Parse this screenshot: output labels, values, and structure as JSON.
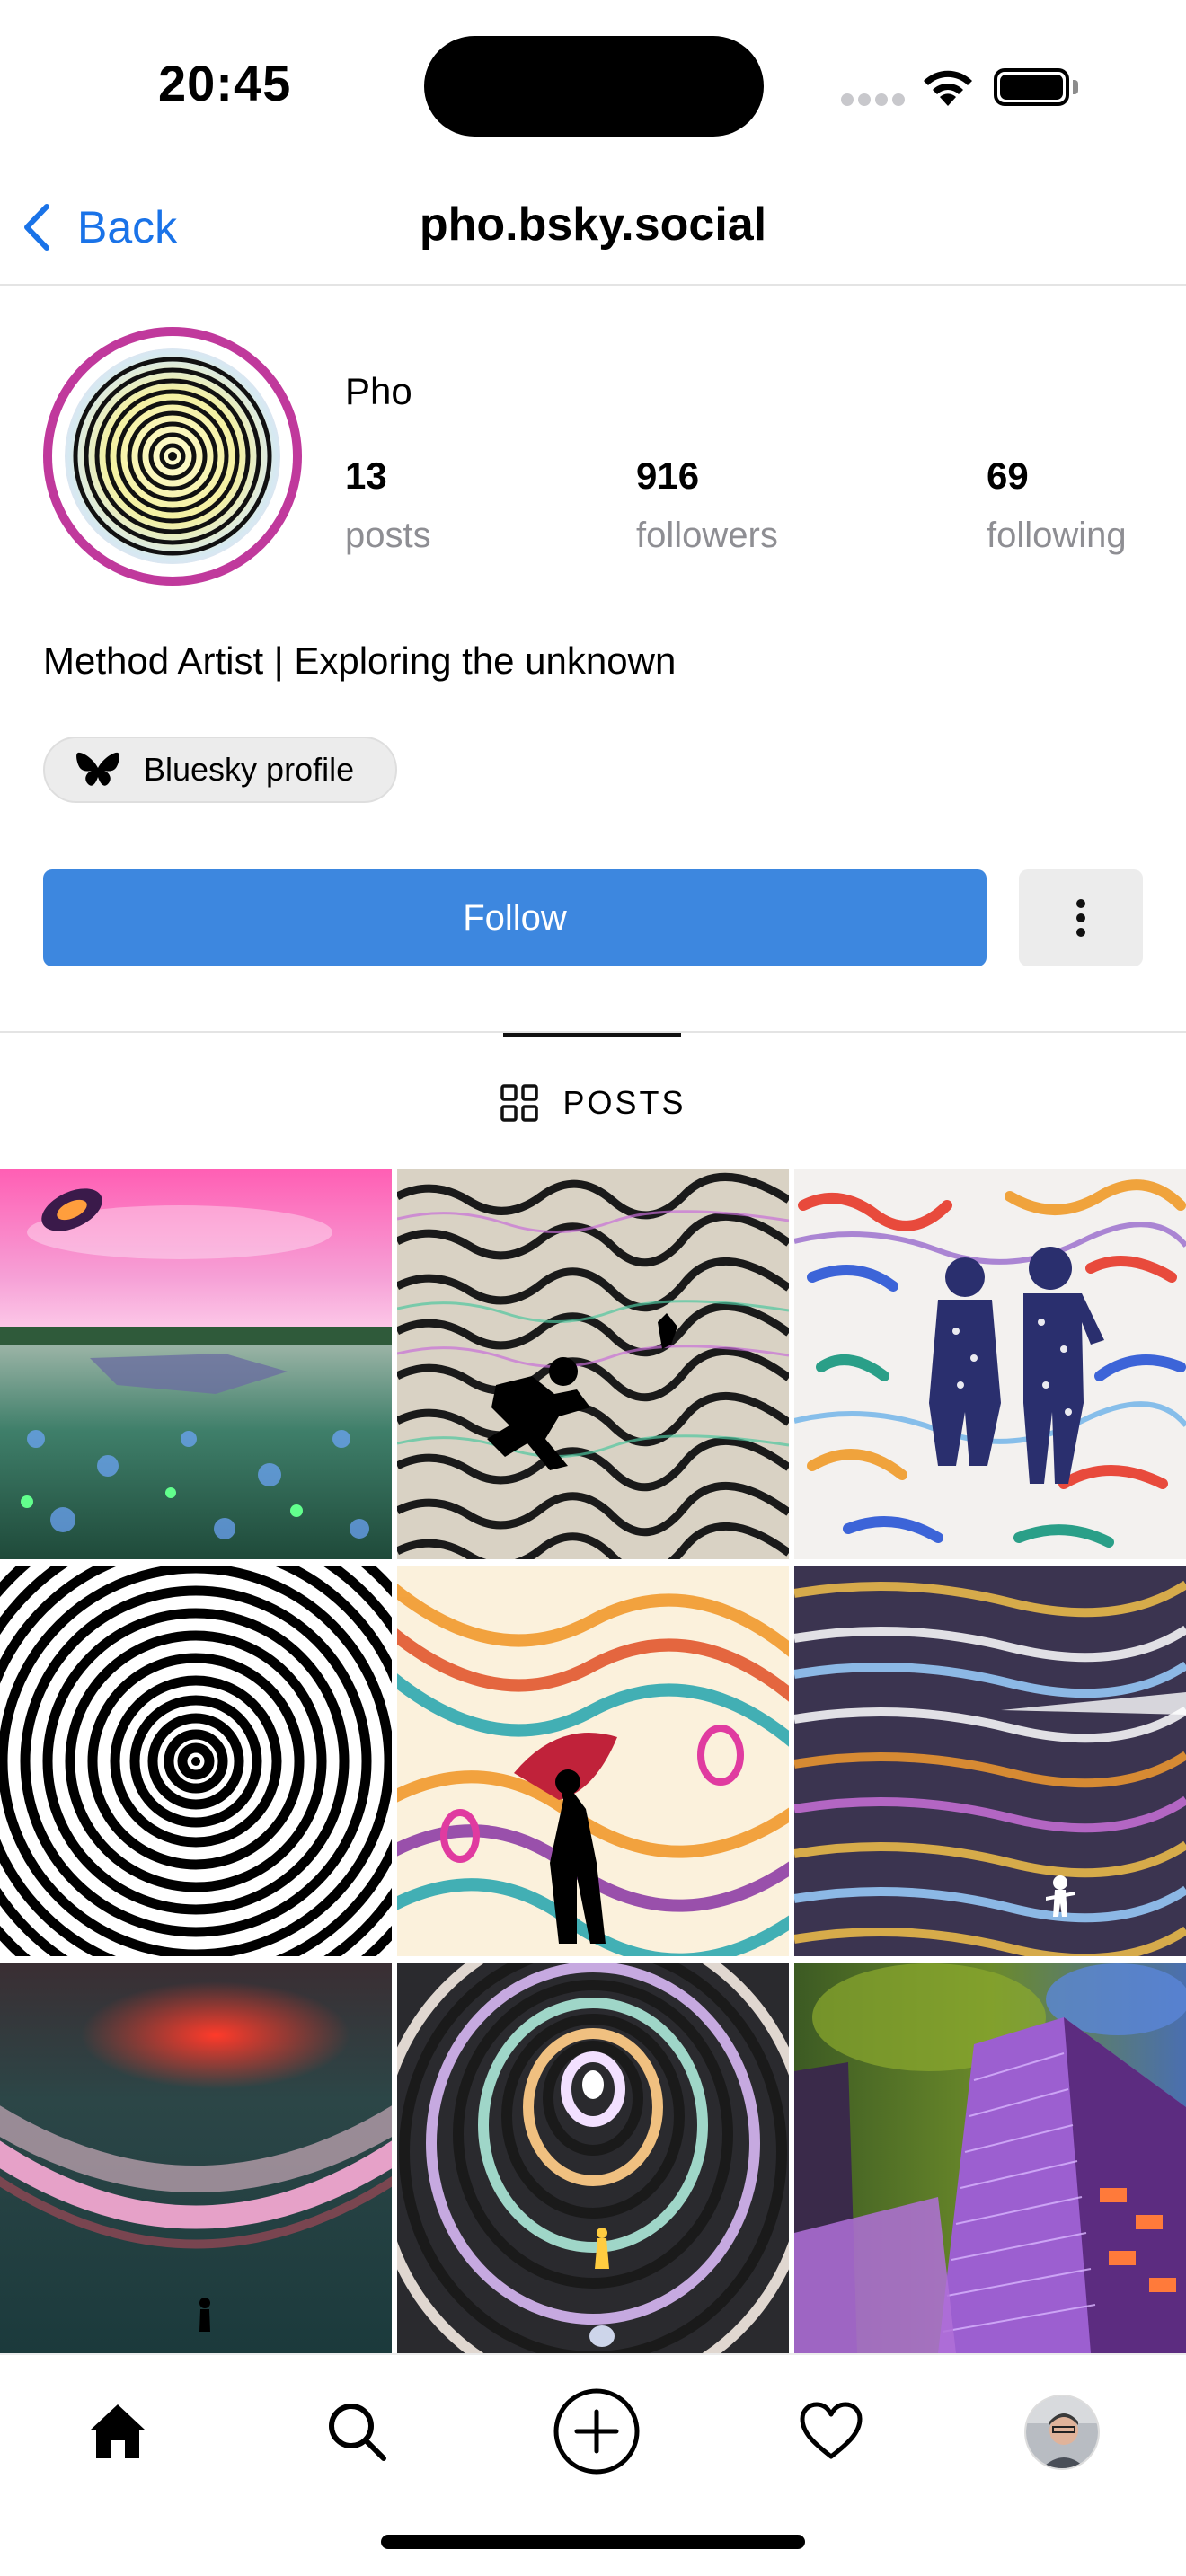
{
  "status_bar": {
    "time": "20:45"
  },
  "nav": {
    "back_label": "Back",
    "title": "pho.bsky.social"
  },
  "profile": {
    "display_name": "Pho",
    "stats": [
      {
        "value": "13",
        "label": "posts"
      },
      {
        "value": "916",
        "label": "followers"
      },
      {
        "value": "69",
        "label": "following"
      }
    ],
    "bio": "Method Artist | Exploring the unknown",
    "bluesky_chip_label": "Bluesky profile"
  },
  "actions": {
    "follow_label": "Follow",
    "more_icon": "more-vertical-icon"
  },
  "tabs": {
    "posts_label": "POSTS",
    "posts_icon": "grid-icon"
  },
  "posts_grid": {
    "tiles": [
      "meadow-pink-sky",
      "psychedelic-runner",
      "flag-figures",
      "hypnotic-spiral",
      "melting-umbrella",
      "light-streaks",
      "red-horizon",
      "spiral-tunnel",
      "purple-building"
    ]
  },
  "tab_bar": {
    "items": [
      "home-icon",
      "search-icon",
      "add-icon",
      "heart-icon",
      "profile-avatar"
    ]
  },
  "colors": {
    "accent": "#1a73e8",
    "follow_button": "#3d87df",
    "avatar_ring": "#c0399c",
    "secondary_text": "#8e8e93"
  }
}
